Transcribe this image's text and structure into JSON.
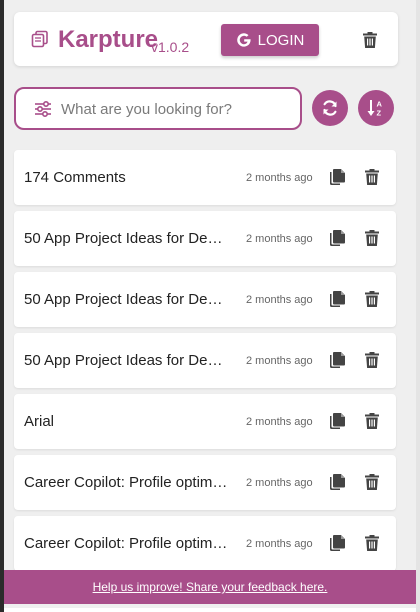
{
  "header": {
    "brand": "Karpture",
    "version": "v1.0.2",
    "login_label": "LOGIN"
  },
  "search": {
    "placeholder": "What are you looking for?",
    "value": ""
  },
  "items": [
    {
      "title": "174 Comments",
      "time": "2 months ago"
    },
    {
      "title": "50 App Project Ideas for Dev…",
      "time": "2 months ago"
    },
    {
      "title": "50 App Project Ideas for Dev…",
      "time": "2 months ago"
    },
    {
      "title": "50 App Project Ideas for Dev…",
      "time": "2 months ago"
    },
    {
      "title": "Arial",
      "time": "2 months ago"
    },
    {
      "title": "Career Copilot: Profile optimi…",
      "time": "2 months ago"
    },
    {
      "title": "Career Copilot: Profile optimi…",
      "time": "2 months ago"
    }
  ],
  "footer": {
    "feedback_link": "Help us improve! Share your feedback here."
  },
  "icons": {
    "logo": "copy-icon",
    "login": "google-icon",
    "filter": "sliders-icon",
    "refresh": "refresh-icon",
    "sort": "sort-icon",
    "item_copy": "copy-icon",
    "item_delete": "trash-icon"
  },
  "colors": {
    "accent": "#a84e8a",
    "background": "#efefef",
    "card": "#ffffff"
  }
}
